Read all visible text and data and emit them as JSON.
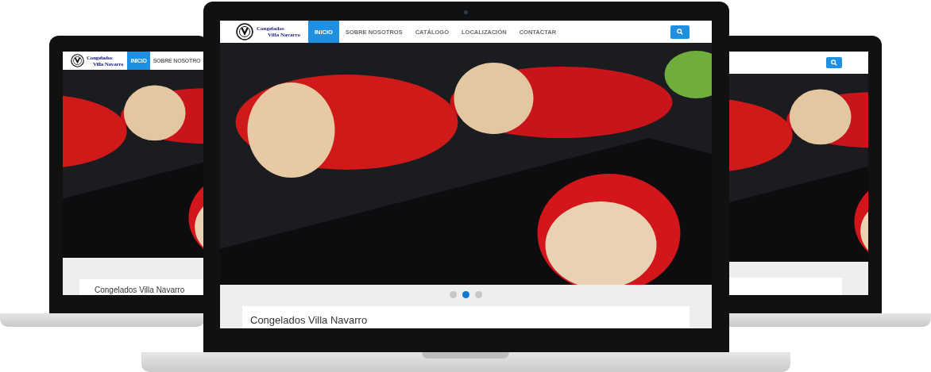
{
  "laptops": [
    {
      "logo": {
        "line_1": "Congelados",
        "line_2": "Villa Navarro"
      },
      "nav": [
        {
          "label": "INICIO",
          "selected": true
        },
        {
          "label": "SOBRE NOSOTRO",
          "selected": false
        }
      ],
      "card_title": "Congelados Villa Navarro"
    },
    {
      "search_button": true
    },
    {
      "logo": {
        "line_1": "Congelados",
        "line_2": "Villa Navarro"
      },
      "nav": [
        {
          "label": "INICIO",
          "selected": true
        },
        {
          "label": "SOBRE NOSOTROS",
          "selected": false
        },
        {
          "label": "CATÁLOGO",
          "selected": false
        },
        {
          "label": "LOCALIZACIÓN",
          "selected": false
        },
        {
          "label": "CONTACTAR",
          "selected": false
        }
      ],
      "search_button": true,
      "slider_dots": [
        {
          "selected": false
        },
        {
          "selected": true
        },
        {
          "selected": false
        }
      ],
      "card_title": "Congelados Villa Navarro"
    }
  ]
}
